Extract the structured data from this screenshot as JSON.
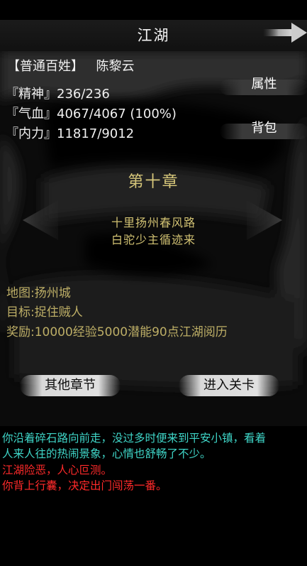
{
  "header": {
    "title": "江湖",
    "next_icon": "arrow-right-icon"
  },
  "player": {
    "rank": "【普通百姓】",
    "name": "陈黎云",
    "stats": [
      {
        "label": "『精神』",
        "value": "236/236"
      },
      {
        "label": "『气血』",
        "value": "4067/4067 (100%)"
      },
      {
        "label": "『内力』",
        "value": "11817/9012"
      }
    ]
  },
  "buttons": {
    "attributes": "属性",
    "bag": "背包",
    "other_chapters": "其他章节",
    "enter_stage": "进入关卡"
  },
  "chapter": {
    "title": "第十章",
    "subtitle_line1": "十里扬州春风路",
    "subtitle_line2": "白驼少主循迹来",
    "prev_icon": "triangle-left-icon",
    "next_icon": "triangle-right-icon"
  },
  "mission": {
    "map": "地图:扬州城",
    "goal": "目标:捉住贼人",
    "reward": "奖励:10000经验5000潜能90点江湖阅历"
  },
  "log": {
    "lines": [
      {
        "text": "你沿着碎石路向前走，没过多时便来到平安小镇，看着",
        "color": "#3fd6c8"
      },
      {
        "text": "人来人往的热闹景象，心情也舒畅了不少。",
        "color": "#3fd6c8"
      },
      {
        "text": "江湖险恶，人心叵测。",
        "color": "#ff2a2a"
      },
      {
        "text": "你背上行囊，决定出门闯荡一番。",
        "color": "#ff2a2a"
      }
    ]
  },
  "colors": {
    "gold": "#d7c77a",
    "cyan": "#3fd6c8",
    "red": "#ff2a2a"
  }
}
